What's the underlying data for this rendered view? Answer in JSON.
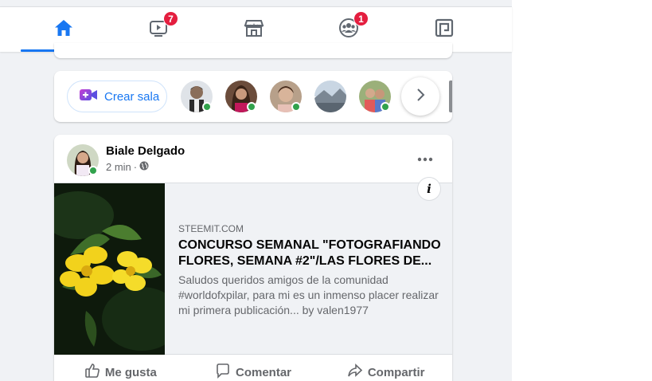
{
  "nav": {
    "tabs": [
      {
        "name": "home",
        "icon": "home-icon",
        "active": true
      },
      {
        "name": "watch",
        "icon": "video-icon",
        "badge": "7"
      },
      {
        "name": "marketplace",
        "icon": "store-icon"
      },
      {
        "name": "groups",
        "icon": "groups-icon",
        "badge": "1"
      },
      {
        "name": "gaming",
        "icon": "gaming-icon"
      }
    ]
  },
  "rooms": {
    "create_label": "Crear sala",
    "friends_online": 5
  },
  "post": {
    "author": "Biale Delgado",
    "time": "2 min",
    "separator": "·",
    "link": {
      "domain": "STEEMIT.COM",
      "title": "CONCURSO SEMANAL \"FOTOGRAFIANDO FLORES, SEMANA #2\"/LAS FLORES DE...",
      "description": "Saludos queridos amigos de la comunidad #worldofxpilar, para mi es un inmenso placer realizar mi primera publicación... by valen1977",
      "info_label": "i"
    },
    "actions": {
      "like": "Me gusta",
      "comment": "Comentar",
      "share": "Compartir"
    }
  },
  "colors": {
    "accent": "#1877f2",
    "badge": "#e41e3f",
    "online": "#31a24c",
    "background": "#f0f2f5"
  }
}
